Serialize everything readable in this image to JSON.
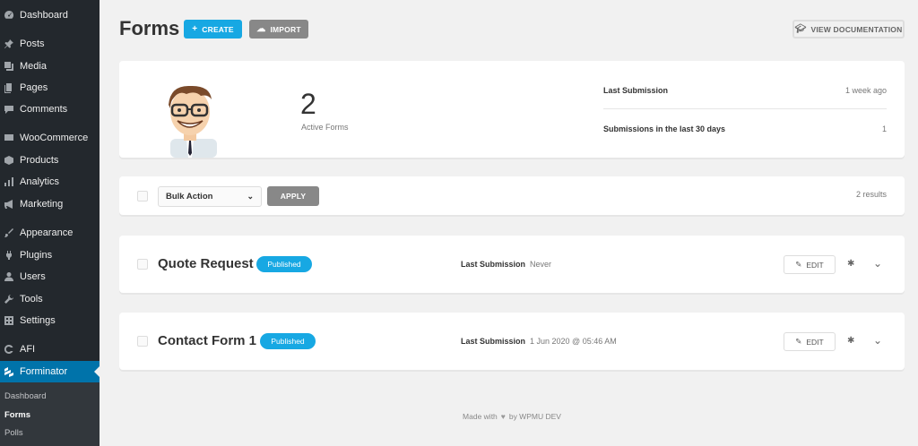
{
  "sidebar": {
    "items": [
      {
        "label": "Dashboard",
        "icon": "dashboard-icon"
      },
      {
        "label": "Posts",
        "icon": "pin-icon"
      },
      {
        "label": "Media",
        "icon": "media-icon"
      },
      {
        "label": "Pages",
        "icon": "pages-icon"
      },
      {
        "label": "Comments",
        "icon": "comment-icon"
      },
      {
        "label": "WooCommerce",
        "icon": "woo-icon"
      },
      {
        "label": "Products",
        "icon": "box-icon"
      },
      {
        "label": "Analytics",
        "icon": "bar-chart-icon"
      },
      {
        "label": "Marketing",
        "icon": "megaphone-icon"
      },
      {
        "label": "Appearance",
        "icon": "brush-icon"
      },
      {
        "label": "Plugins",
        "icon": "plug-icon"
      },
      {
        "label": "Users",
        "icon": "user-icon"
      },
      {
        "label": "Tools",
        "icon": "wrench-icon"
      },
      {
        "label": "Settings",
        "icon": "settings-icon"
      },
      {
        "label": "AFI",
        "icon": "afi-icon"
      },
      {
        "label": "Forminator",
        "icon": "forminator-icon"
      }
    ],
    "submenu": [
      "Dashboard",
      "Forms",
      "Polls"
    ]
  },
  "header": {
    "title": "Forms",
    "create_label": "CREATE",
    "import_label": "IMPORT",
    "docs_label": "VIEW DOCUMENTATION"
  },
  "summary": {
    "active_count": "2",
    "active_label": "Active Forms",
    "last_submission_label": "Last Submission",
    "last_submission_value": "1 week ago",
    "last30_label": "Submissions in the last 30 days",
    "last30_value": "1"
  },
  "bulk": {
    "action_label": "Bulk Action",
    "apply_label": "APPLY",
    "results": "2 results"
  },
  "forms": [
    {
      "title": "Quote Request",
      "status": "Published",
      "last_label": "Last Submission",
      "last_value": "Never",
      "edit_label": "EDIT"
    },
    {
      "title": "Contact Form 1",
      "status": "Published",
      "last_label": "Last Submission",
      "last_value": "1 Jun 2020 @ 05:46 AM",
      "edit_label": "EDIT"
    }
  ],
  "footer": {
    "made_with": "Made with",
    "by": "by WPMU DEV"
  },
  "colors": {
    "accent": "#17a8e3",
    "sidebar_bg": "#23282d",
    "active_menu": "#0073aa"
  }
}
